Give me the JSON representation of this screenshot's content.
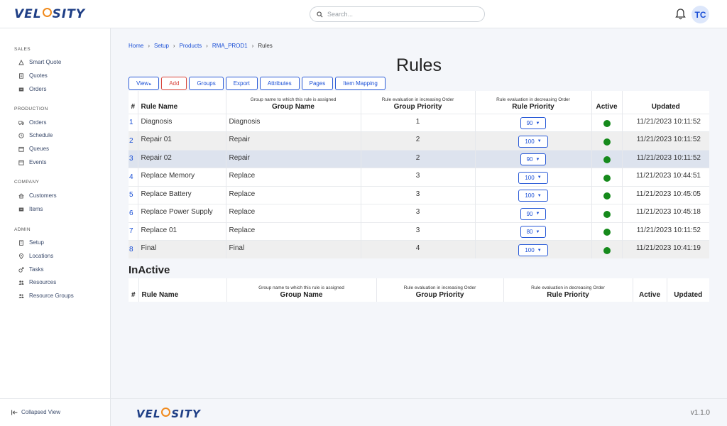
{
  "app": {
    "logo_text_a": "VEL",
    "logo_text_b": "SITY",
    "version": "v1.1.0",
    "user_initials": "TC"
  },
  "search": {
    "placeholder": "Search..."
  },
  "sidebar": {
    "sections": [
      {
        "title": "SALES",
        "items": [
          {
            "label": "Smart Quote",
            "icon": "cone-icon"
          },
          {
            "label": "Quotes",
            "icon": "document-icon"
          },
          {
            "label": "Orders",
            "icon": "inbox-icon"
          }
        ]
      },
      {
        "title": "PRODUCTION",
        "items": [
          {
            "label": "Orders",
            "icon": "truck-icon"
          },
          {
            "label": "Schedule",
            "icon": "clock-icon"
          },
          {
            "label": "Queues",
            "icon": "calendar-icon"
          },
          {
            "label": "Events",
            "icon": "calendar-icon"
          }
        ]
      },
      {
        "title": "COMPANY",
        "items": [
          {
            "label": "Customers",
            "icon": "home-icon"
          },
          {
            "label": "Items",
            "icon": "inbox-icon"
          }
        ]
      },
      {
        "title": "ADMIN",
        "items": [
          {
            "label": "Setup",
            "icon": "building-icon"
          },
          {
            "label": "Locations",
            "icon": "pin-icon"
          },
          {
            "label": "Tasks",
            "icon": "male-icon"
          },
          {
            "label": "Resources",
            "icon": "people-icon"
          },
          {
            "label": "Resource Groups",
            "icon": "people-icon"
          }
        ]
      }
    ],
    "collapse_label": "Collapsed View"
  },
  "breadcrumb": {
    "items": [
      "Home",
      "Setup",
      "Products",
      "RMA_PROD1"
    ],
    "current": "Rules"
  },
  "page": {
    "title": "Rules",
    "inactive_title": "InActive"
  },
  "toolbar": {
    "view": "View",
    "add": "Add",
    "groups": "Groups",
    "export": "Export",
    "attributes": "Attributes",
    "pages": "Pages",
    "item_mapping": "Item Mapping"
  },
  "table": {
    "headers": {
      "num": "#",
      "rule_name": "Rule Name",
      "group_name_sub": "Group name to which this rule is assigned",
      "group_name": "Group Name",
      "group_priority_sub": "Rule evaluation in increasing Order",
      "group_priority": "Group Priority",
      "rule_priority_sub": "Rule evaluation in decreasing Order",
      "rule_priority": "Rule Priority",
      "active": "Active",
      "updated": "Updated"
    },
    "rows": [
      {
        "num": "1",
        "rule_name": "Diagnosis",
        "group_name": "Diagnosis",
        "group_priority": "1",
        "rule_priority": "90",
        "active": true,
        "updated": "11/21/2023 10:11:52"
      },
      {
        "num": "2",
        "rule_name": "Repair 01",
        "group_name": "Repair",
        "group_priority": "2",
        "rule_priority": "100",
        "active": true,
        "updated": "11/21/2023 10:11:52"
      },
      {
        "num": "3",
        "rule_name": "Repair 02",
        "group_name": "Repair",
        "group_priority": "2",
        "rule_priority": "90",
        "active": true,
        "updated": "11/21/2023 10:11:52"
      },
      {
        "num": "4",
        "rule_name": "Replace Memory",
        "group_name": "Replace",
        "group_priority": "3",
        "rule_priority": "100",
        "active": true,
        "updated": "11/21/2023 10:44:51"
      },
      {
        "num": "5",
        "rule_name": "Replace Battery",
        "group_name": "Replace",
        "group_priority": "3",
        "rule_priority": "100",
        "active": true,
        "updated": "11/21/2023 10:45:05"
      },
      {
        "num": "6",
        "rule_name": "Replace Power Supply",
        "group_name": "Replace",
        "group_priority": "3",
        "rule_priority": "90",
        "active": true,
        "updated": "11/21/2023 10:45:18"
      },
      {
        "num": "7",
        "rule_name": "Replace 01",
        "group_name": "Replace",
        "group_priority": "3",
        "rule_priority": "80",
        "active": true,
        "updated": "11/21/2023 10:11:52"
      },
      {
        "num": "8",
        "rule_name": "Final",
        "group_name": "Final",
        "group_priority": "4",
        "rule_priority": "100",
        "active": true,
        "updated": "11/21/2023 10:41:19"
      }
    ]
  },
  "colors": {
    "accent": "#1a4fd6",
    "add_button": "#d9453b",
    "active_dot": "#168a1c",
    "logo_orb": "#f08a1c"
  }
}
